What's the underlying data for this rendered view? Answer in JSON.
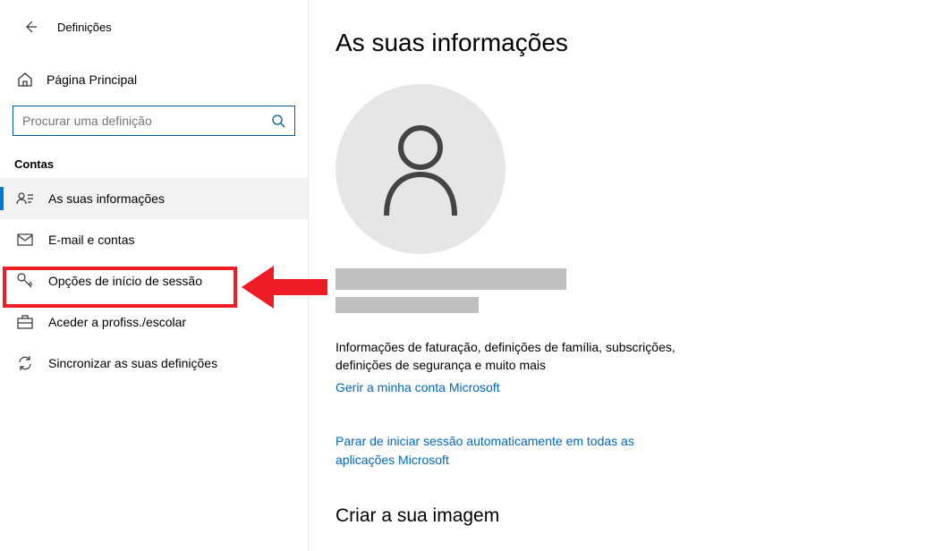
{
  "window": {
    "title": "Definições"
  },
  "home": {
    "label": "Página Principal"
  },
  "search": {
    "placeholder": "Procurar uma definição"
  },
  "section": {
    "title": "Contas"
  },
  "nav": {
    "items": [
      {
        "label": "As suas informações"
      },
      {
        "label": "E-mail e contas"
      },
      {
        "label": "Opções de início de sessão"
      },
      {
        "label": "Aceder a profiss./escolar"
      },
      {
        "label": "Sincronizar as suas definições"
      }
    ]
  },
  "main": {
    "title": "As suas informações",
    "billing_text": "Informações de faturação, definições de família, subscrições, definições de segurança e muito mais",
    "manage_link": "Gerir a minha conta Microsoft",
    "stop_signin_link": "Parar de iniciar sessão automaticamente em todas as aplicações Microsoft",
    "create_image": "Criar a sua imagem"
  }
}
